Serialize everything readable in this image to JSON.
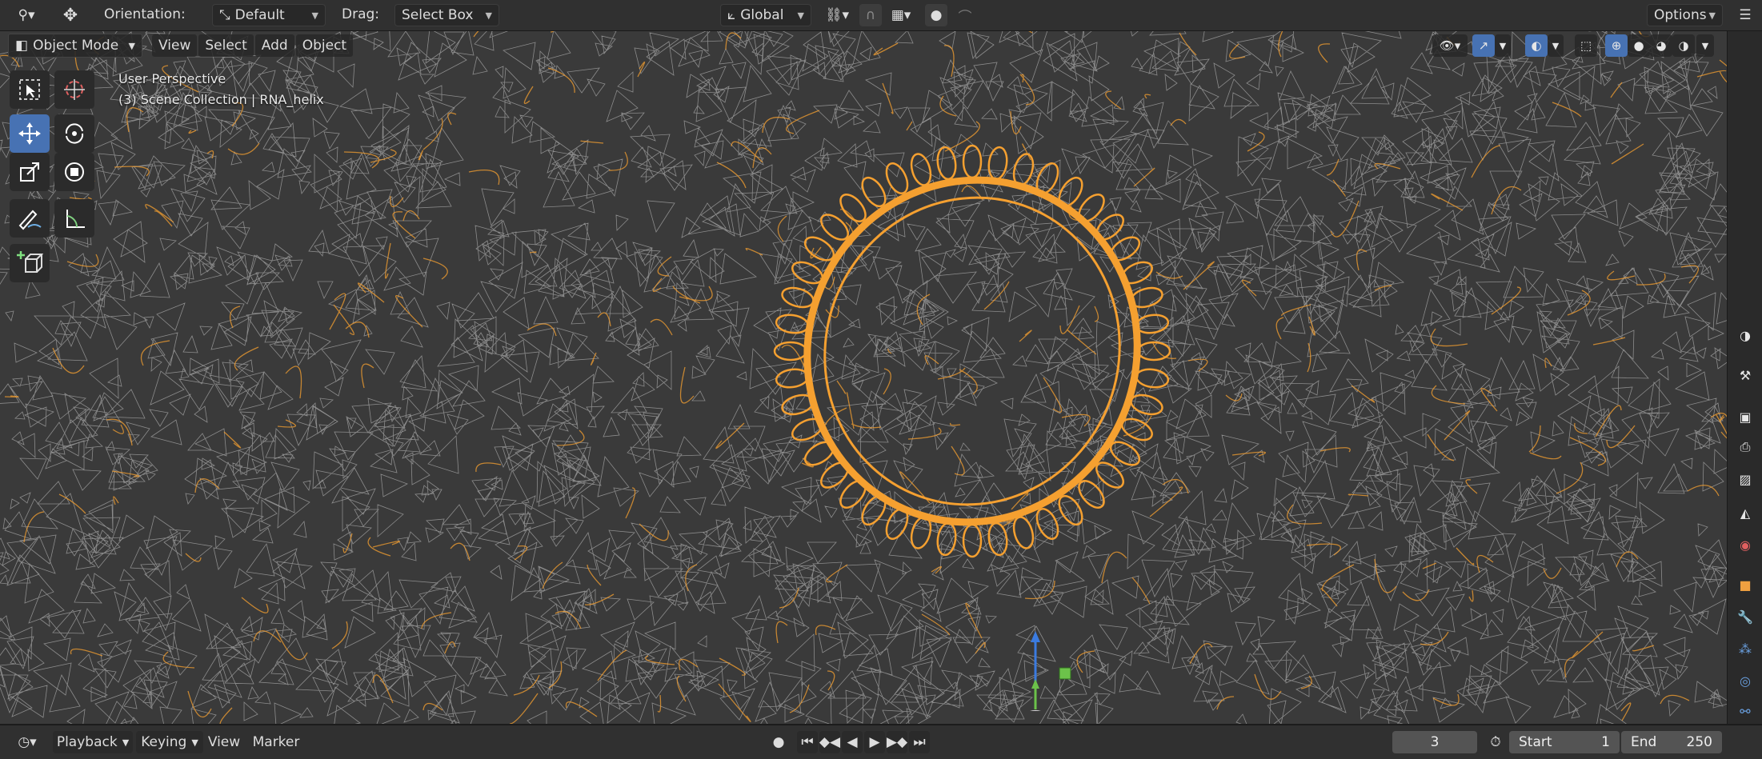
{
  "topbar": {
    "orientation_label": "Orientation:",
    "orientation_value": "Default",
    "drag_label": "Drag:",
    "drag_value": "Select Box",
    "transform_space": "Global",
    "options_label": "Options"
  },
  "viewport_header": {
    "mode": "Object Mode",
    "menus": [
      "View",
      "Select",
      "Add",
      "Object"
    ]
  },
  "viewport_overlay": {
    "perspective": "User Perspective",
    "collection": "(3) Scene Collection | RNA_helix"
  },
  "toolbar_tools": [
    {
      "name": "select-box-tool",
      "icon": "select-box-icon"
    },
    {
      "name": "cursor-tool",
      "icon": "cursor-icon"
    },
    {
      "name": "move-tool",
      "icon": "move-icon",
      "active": true
    },
    {
      "name": "rotate-tool",
      "icon": "rotate-icon"
    },
    {
      "name": "scale-tool",
      "icon": "scale-icon"
    },
    {
      "name": "transform-tool",
      "icon": "transform-icon"
    },
    {
      "name": "annotate-tool",
      "icon": "annotate-icon"
    },
    {
      "name": "measure-tool",
      "icon": "measure-icon"
    },
    {
      "name": "add-cube-tool",
      "icon": "add-cube-icon"
    }
  ],
  "timeline": {
    "menus": [
      "Playback",
      "Keying",
      "View",
      "Marker"
    ],
    "current_frame": "3",
    "start_label": "Start",
    "start_value": "1",
    "end_label": "End",
    "end_value": "250"
  },
  "colors": {
    "selected_wire": "#f5a030",
    "wire": "#cfcfcf",
    "viewport_bg": "#3a3a3a",
    "accent": "#4772b3"
  }
}
